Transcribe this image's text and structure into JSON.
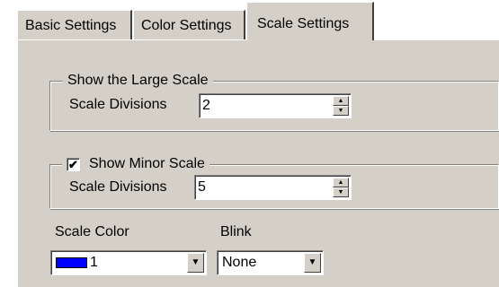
{
  "tabs": [
    {
      "label": "Basic Settings",
      "selected": false
    },
    {
      "label": "Color Settings",
      "selected": false
    },
    {
      "label": "Scale Settings",
      "selected": true
    }
  ],
  "large_scale": {
    "title": "Show the Large Scale",
    "divisions_label": "Scale Divisions",
    "divisions_value": "2"
  },
  "minor_scale": {
    "title": "Show Minor Scale",
    "checked": true,
    "divisions_label": "Scale Divisions",
    "divisions_value": "5"
  },
  "scale_color": {
    "label": "Scale Color",
    "value": "1",
    "swatch_color": "#0000ff"
  },
  "blink": {
    "label": "Blink",
    "value": "None"
  },
  "icons": {
    "check": "checkmark-icon",
    "spin_up": "spin-up-arrow-icon",
    "spin_down": "spin-down-arrow-icon",
    "dropdown": "dropdown-arrow-icon"
  }
}
